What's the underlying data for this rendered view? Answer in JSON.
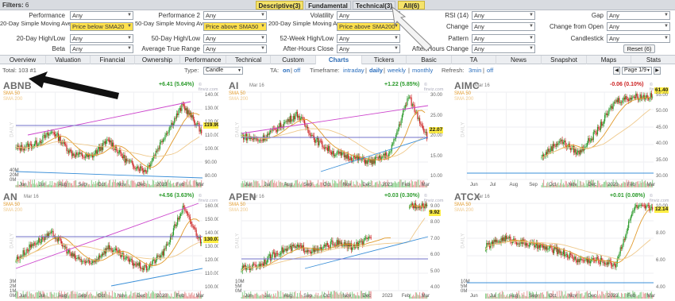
{
  "filters_bar": {
    "label": "Filters:",
    "count": "6",
    "tabs": [
      {
        "label": "Descriptive(3)",
        "active": true
      },
      {
        "label": "Fundamental",
        "active": false
      },
      {
        "label": "Technical(3)",
        "active": false
      },
      {
        "label": "All(6)",
        "active": true
      }
    ]
  },
  "filter_rows": [
    [
      {
        "label": "Performance",
        "value": "Any"
      },
      {
        "label": "Performance 2",
        "value": "Any"
      },
      {
        "label": "Volatility",
        "value": "Any"
      },
      {
        "label": "RSI (14)",
        "value": "Any"
      },
      {
        "label": "Gap",
        "value": "Any"
      }
    ],
    [
      {
        "label": "20-Day Simple Moving Average",
        "value": "Price below SMA20"
      },
      {
        "label": "50-Day Simple Moving Average",
        "value": "Price above SMA50"
      },
      {
        "label": "200-Day Simple Moving Average",
        "value": "Price above SMA200"
      },
      {
        "label": "Change",
        "value": "Any"
      },
      {
        "label": "Change from Open",
        "value": "Any"
      }
    ],
    [
      {
        "label": "20-Day High/Low",
        "value": "Any"
      },
      {
        "label": "50-Day High/Low",
        "value": "Any"
      },
      {
        "label": "52-Week High/Low",
        "value": "Any"
      },
      {
        "label": "Pattern",
        "value": "Any"
      },
      {
        "label": "Candlestick",
        "value": "Any"
      }
    ],
    [
      {
        "label": "Beta",
        "value": "Any"
      },
      {
        "label": "Average True Range",
        "value": "Any"
      },
      {
        "label": "After-Hours Close",
        "value": "Any"
      },
      {
        "label": "After-Hours Change",
        "value": "Any"
      }
    ]
  ],
  "reset_label": "Reset (6)",
  "nav_tabs": [
    "Overview",
    "Valuation",
    "Financial",
    "Ownership",
    "Performance",
    "Technical",
    "Custom",
    "Charts",
    "Tickers",
    "Basic",
    "TA",
    "News",
    "Snapshot",
    "Maps",
    "Stats"
  ],
  "nav_active": "Charts",
  "toolbar": {
    "total_label": "Total:",
    "total_value": "103 #1",
    "type_label": "Type:",
    "type_value": "Candle",
    "ta_label": "TA:",
    "ta_on": "on",
    "ta_sep": "|",
    "ta_off": "off",
    "timeframe_label": "Timeframe:",
    "tf_intraday": "intraday",
    "tf_daily": "daily",
    "tf_weekly": "weekly",
    "tf_monthly": "monthly",
    "refresh_label": "Refresh:",
    "refresh_3min": "3min",
    "refresh_off": "off",
    "page_value": "Page 1/9"
  },
  "charts": [
    {
      "ticker": "ABNB",
      "date": "",
      "change": "+6.41 (5.64%)",
      "direction": "up",
      "price": "119.99",
      "yticks": [
        "140.00",
        "130.00",
        "120.00",
        "110.00",
        "100.00",
        "90.00",
        "80.00"
      ],
      "vol_ticks": [
        "40M",
        "20M",
        "0M"
      ],
      "xticks": [
        "Jun",
        "Jul",
        "Aug",
        "Sep",
        "Oct",
        "Nov",
        "Dec",
        "2023",
        "Feb",
        "Mar"
      ]
    },
    {
      "ticker": "AI",
      "date": "Mar 16",
      "change": "+1.22 (5.85%)",
      "direction": "up",
      "price": "22.07",
      "yticks": [
        "30.00",
        "25.00",
        "20.00",
        "15.00",
        "10.00"
      ],
      "vol_ticks": [],
      "xticks": [
        "Jun",
        "Jul",
        "Aug",
        "Sep",
        "Oct",
        "Nov",
        "Dec",
        "2023",
        "Feb",
        "Mar"
      ]
    },
    {
      "ticker": "AIMC",
      "date": "Mar 16",
      "change": "-0.06 (0.10%)",
      "direction": "down",
      "price": "61.40",
      "yticks": [
        "55.00",
        "50.00",
        "45.00",
        "40.00",
        "35.00",
        "30.00"
      ],
      "vol_ticks": [],
      "xticks": [
        "Jun",
        "Jul",
        "Aug",
        "Sep",
        "Oct",
        "Nov",
        "Dec",
        "2023",
        "Feb",
        "Mar"
      ]
    },
    {
      "ticker": "AN",
      "date": "Mar 16",
      "change": "+4.56 (3.63%)",
      "direction": "up",
      "price": "130.07",
      "yticks": [
        "160.00",
        "150.00",
        "140.00",
        "130.00",
        "120.00",
        "110.00",
        "100.00"
      ],
      "vol_ticks": [
        "3M",
        "2M",
        "1M",
        "0M"
      ],
      "xticks": [
        "Jun",
        "Jul",
        "Aug",
        "Sep",
        "Oct",
        "Nov",
        "Dec",
        "2023",
        "Feb",
        "Mar"
      ]
    },
    {
      "ticker": "APEN",
      "date": "Mar 16",
      "change": "+0.03 (0.30%)",
      "direction": "up",
      "price": "9.92",
      "yticks": [
        "9.00",
        "8.00",
        "7.00",
        "6.00",
        "5.00",
        "4.00"
      ],
      "vol_ticks": [
        "10M",
        "5M",
        "0M"
      ],
      "xticks": [
        "Jun",
        "Jul",
        "Aug",
        "Sep",
        "Oct",
        "Nov",
        "Dec",
        "2023",
        "Feb",
        "Mar"
      ]
    },
    {
      "ticker": "ATCX",
      "date": "Mar 16",
      "change": "+0.01 (0.08%)",
      "direction": "up",
      "price": "12.14",
      "yticks": [
        "10.00",
        "8.00",
        "6.00",
        "4.00"
      ],
      "vol_ticks": [
        "10M",
        "5M",
        "0M"
      ],
      "xticks": [
        "Jun",
        "Jul",
        "Aug",
        "Sep",
        "Oct",
        "Nov",
        "Dec",
        "2023",
        "Feb",
        "Mar"
      ]
    }
  ],
  "sma50_label": "SMA 50",
  "sma200_label": "SMA 200",
  "daily_label": "DAILY",
  "watermark": "© finviz.com",
  "colors": {
    "accent": "#2f6db5",
    "highlight": "#ffe14d",
    "up": "#2a9a2a",
    "down": "#cc2222",
    "trend_upper": "#cc44cc",
    "trend_lower": "#3a8fd8"
  }
}
